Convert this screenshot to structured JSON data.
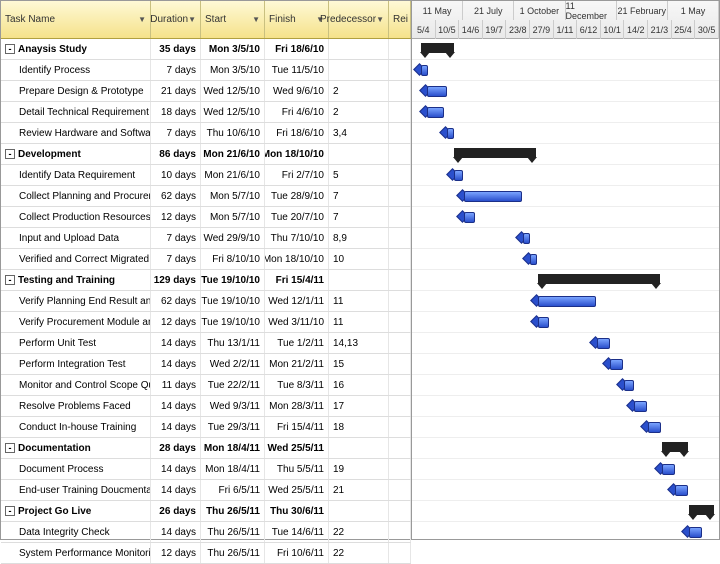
{
  "columns": {
    "task": "Task Name",
    "duration": "Duration",
    "start": "Start",
    "finish": "Finish",
    "predecessor": "Predecessor",
    "rei": "Rei"
  },
  "timeline_months": [
    "11 May",
    "21 July",
    "1 October",
    "11 December",
    "21 February",
    "1 May"
  ],
  "timeline_ticks": [
    "5/4",
    "10/5",
    "14/6",
    "19/7",
    "23/8",
    "27/9",
    "1/11",
    "6/12",
    "10/1",
    "14/2",
    "21/3",
    "25/4",
    "30/5"
  ],
  "rows": [
    {
      "id": "r1",
      "type": "summary",
      "task": "Anaysis Study",
      "dur": "35 days",
      "start": "Mon 3/5/10",
      "finish": "Fri 18/6/10",
      "pred": "",
      "bar": [
        9,
        33
      ]
    },
    {
      "id": "r2",
      "type": "task",
      "task": "Identify Process",
      "dur": "7 days",
      "start": "Mon 3/5/10",
      "finish": "Tue 11/5/10",
      "pred": "",
      "bar": [
        9,
        7
      ]
    },
    {
      "id": "r3",
      "type": "task",
      "task": "Prepare Design & Prototype",
      "dur": "21 days",
      "start": "Wed 12/5/10",
      "finish": "Wed 9/6/10",
      "pred": "2",
      "bar": [
        15,
        20
      ]
    },
    {
      "id": "r4",
      "type": "task",
      "task": "Detail Technical Requirement",
      "dur": "18 days",
      "start": "Wed 12/5/10",
      "finish": "Fri 4/6/10",
      "pred": "2",
      "bar": [
        15,
        17
      ]
    },
    {
      "id": "r5",
      "type": "task",
      "task": "Review Hardware and Software",
      "dur": "7 days",
      "start": "Thu 10/6/10",
      "finish": "Fri 18/6/10",
      "pred": "3,4",
      "bar": [
        35,
        7
      ]
    },
    {
      "id": "r6",
      "type": "summary",
      "task": "Development",
      "dur": "86 days",
      "start": "Mon 21/6/10",
      "finish": "Mon 18/10/10",
      "pred": "",
      "bar": [
        42,
        82
      ]
    },
    {
      "id": "r7",
      "type": "task",
      "task": "Identify Data Requirement",
      "dur": "10 days",
      "start": "Mon 21/6/10",
      "finish": "Fri 2/7/10",
      "pred": "5",
      "bar": [
        42,
        9
      ]
    },
    {
      "id": "r8",
      "type": "task",
      "task": "Collect Planning and Procurement Data",
      "dur": "62 days",
      "start": "Mon 5/7/10",
      "finish": "Tue 28/9/10",
      "pred": "7",
      "bar": [
        52,
        58
      ]
    },
    {
      "id": "r9",
      "type": "task",
      "task": "Collect Production Resources Data",
      "dur": "12 days",
      "start": "Mon 5/7/10",
      "finish": "Tue 20/7/10",
      "pred": "7",
      "bar": [
        52,
        11
      ]
    },
    {
      "id": "r10",
      "type": "task",
      "task": "Input and Upload Data",
      "dur": "7 days",
      "start": "Wed 29/9/10",
      "finish": "Thu 7/10/10",
      "pred": "8,9",
      "bar": [
        111,
        7
      ]
    },
    {
      "id": "r11",
      "type": "task",
      "task": "Verified and Correct Migrated Data",
      "dur": "7 days",
      "start": "Fri 8/10/10",
      "finish": "Mon 18/10/10",
      "pred": "10",
      "bar": [
        118,
        7
      ]
    },
    {
      "id": "r12",
      "type": "summary",
      "task": "Testing and Training",
      "dur": "129 days",
      "start": "Tue 19/10/10",
      "finish": "Fri 15/4/11",
      "pred": "",
      "bar": [
        126,
        122
      ]
    },
    {
      "id": "r13",
      "type": "task",
      "task": "Verify Planning End Result and Schedule",
      "dur": "62 days",
      "start": "Tue 19/10/10",
      "finish": "Wed 12/1/11",
      "pred": "11",
      "bar": [
        126,
        58
      ]
    },
    {
      "id": "r14",
      "type": "task",
      "task": "Verify Procurement Module and Cost End Result",
      "dur": "12 days",
      "start": "Tue 19/10/10",
      "finish": "Wed 3/11/10",
      "pred": "11",
      "bar": [
        126,
        11
      ]
    },
    {
      "id": "r15",
      "type": "task",
      "task": "Perform Unit Test",
      "dur": "14 days",
      "start": "Thu 13/1/11",
      "finish": "Tue 1/2/11",
      "pred": "14,13",
      "bar": [
        185,
        13
      ]
    },
    {
      "id": "r16",
      "type": "task",
      "task": "Perform Integration Test",
      "dur": "14 days",
      "start": "Wed 2/2/11",
      "finish": "Mon 21/2/11",
      "pred": "15",
      "bar": [
        198,
        13
      ]
    },
    {
      "id": "r17",
      "type": "task",
      "task": "Monitor and Control Scope Quality Time and Cost",
      "dur": "11 days",
      "start": "Tue 22/2/11",
      "finish": "Tue 8/3/11",
      "pred": "16",
      "bar": [
        212,
        10
      ]
    },
    {
      "id": "r18",
      "type": "task",
      "task": "Resolve Problems Faced",
      "dur": "14 days",
      "start": "Wed 9/3/11",
      "finish": "Mon 28/3/11",
      "pred": "17",
      "bar": [
        222,
        13
      ]
    },
    {
      "id": "r19",
      "type": "task",
      "task": "Conduct In-house Training",
      "dur": "14 days",
      "start": "Tue 29/3/11",
      "finish": "Fri 15/4/11",
      "pred": "18",
      "bar": [
        236,
        13
      ]
    },
    {
      "id": "r20",
      "type": "summary",
      "task": "Documentation",
      "dur": "28 days",
      "start": "Mon 18/4/11",
      "finish": "Wed 25/5/11",
      "pred": "",
      "bar": [
        250,
        26
      ]
    },
    {
      "id": "r21",
      "type": "task",
      "task": "Document Process",
      "dur": "14 days",
      "start": "Mon 18/4/11",
      "finish": "Thu 5/5/11",
      "pred": "19",
      "bar": [
        250,
        13
      ]
    },
    {
      "id": "r22",
      "type": "task",
      "task": "End-user Training Doucmentation",
      "dur": "14 days",
      "start": "Fri 6/5/11",
      "finish": "Wed 25/5/11",
      "pred": "21",
      "bar": [
        263,
        13
      ]
    },
    {
      "id": "r23",
      "type": "summary",
      "task": "Project Go Live",
      "dur": "26 days",
      "start": "Thu 26/5/11",
      "finish": "Thu 30/6/11",
      "pred": "",
      "bar": [
        277,
        25
      ]
    },
    {
      "id": "r24",
      "type": "task",
      "task": "Data Integrity Check",
      "dur": "14 days",
      "start": "Thu 26/5/11",
      "finish": "Tue 14/6/11",
      "pred": "22",
      "bar": [
        277,
        13
      ]
    },
    {
      "id": "r25",
      "type": "task",
      "task": "System Performance Monitoring",
      "dur": "12 days",
      "start": "Thu 26/5/11",
      "finish": "Fri 10/6/11",
      "pred": "22",
      "bar": [
        277,
        11
      ]
    }
  ]
}
